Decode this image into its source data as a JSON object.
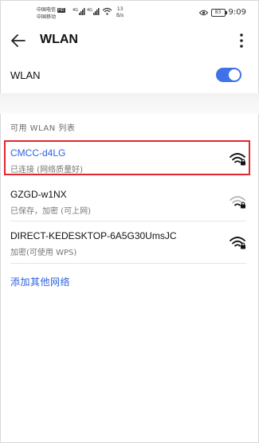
{
  "status_bar": {
    "carrier_1": "中国电信",
    "hd_badge": "HD",
    "carrier_2": "中国移动",
    "net_speed_value": "13",
    "net_speed_unit": "B/s",
    "battery": "83",
    "time": "9:09"
  },
  "header": {
    "title": "WLAN"
  },
  "wlan_toggle": {
    "label": "WLAN",
    "enabled": true
  },
  "section": {
    "label": "可用 WLAN 列表"
  },
  "networks": [
    {
      "name": "CMCC-d4LG",
      "status": "已连接 (网络质量好)",
      "connected": true,
      "locked": true
    },
    {
      "name": "GZGD-w1NX",
      "status": "已保存，加密 (可上网)",
      "connected": false,
      "locked": true
    },
    {
      "name": "DIRECT-KEDESKTOP-6A5G30UmsJC",
      "status": "加密(可使用 WPS)",
      "connected": false,
      "locked": true
    }
  ],
  "add_network": {
    "label": "添加其他网络"
  },
  "colors": {
    "accent": "#3f71e8",
    "connected_text": "#2e63e0",
    "highlight": "#e0282e"
  },
  "icons": {
    "back": "arrow-left-icon",
    "more": "more-vertical-icon",
    "wifi": "wifi-lock-icon"
  }
}
